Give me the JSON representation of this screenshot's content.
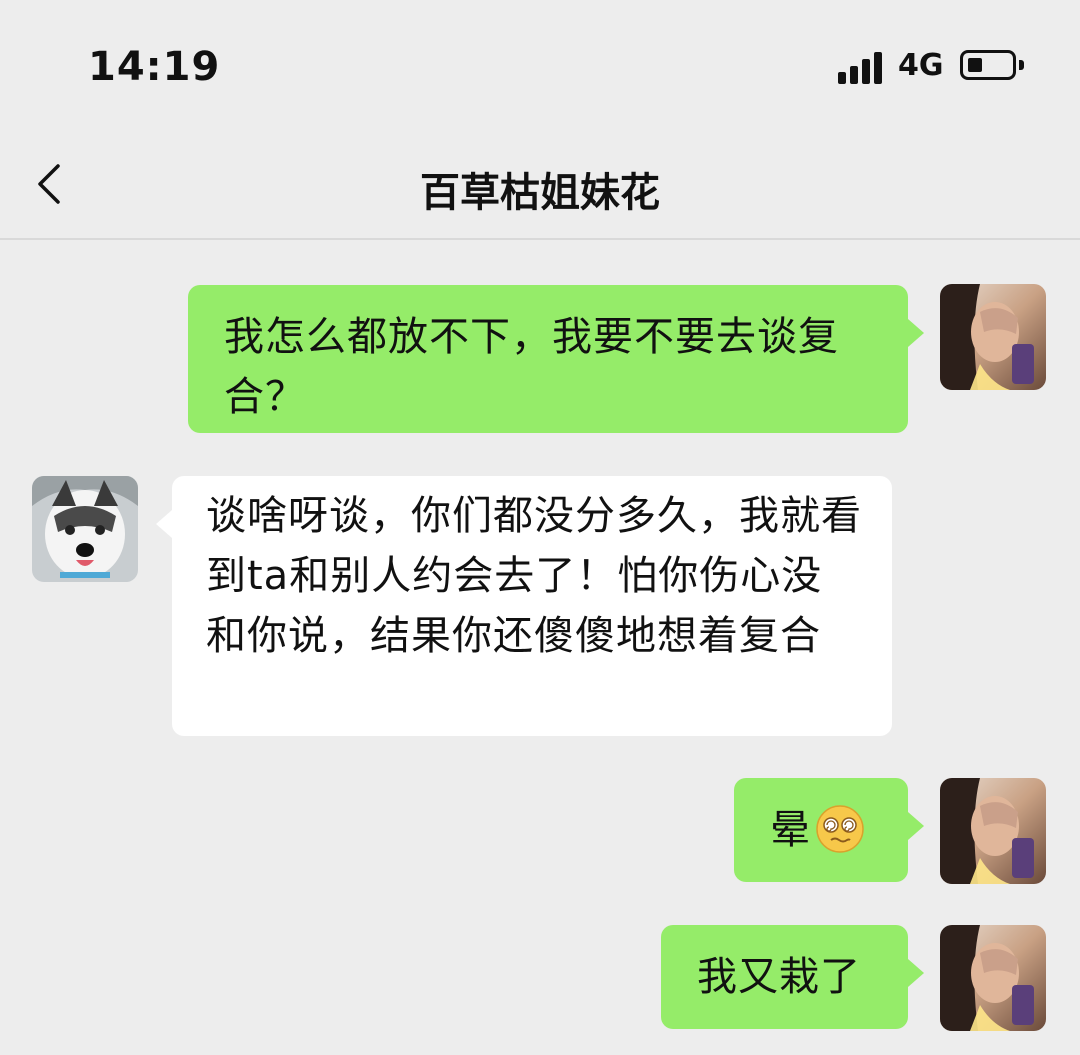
{
  "status_bar": {
    "time": "14:19",
    "network": "4G",
    "signal_bars": 4,
    "battery_level": 0.35,
    "icons": [
      "signal-icon",
      "battery-icon"
    ]
  },
  "header": {
    "title": "百草枯姐妹花",
    "back_icon": "chevron-left-icon"
  },
  "colors": {
    "background": "#ededed",
    "my_bubble": "#95ec69",
    "their_bubble": "#ffffff",
    "text": "#111111"
  },
  "messages": [
    {
      "sender": "me",
      "text": "我怎么都放不下，我要不要去谈复合？"
    },
    {
      "sender": "friend",
      "text": "谈啥呀谈，你们都没分多久，我就看到ta和别人约会去了！怕你伤心没和你说，结果你还傻傻地想着复合"
    },
    {
      "sender": "me",
      "text": "晕",
      "emoji": "dizzy-face-emoji"
    },
    {
      "sender": "me",
      "text": "我又栽了"
    }
  ]
}
